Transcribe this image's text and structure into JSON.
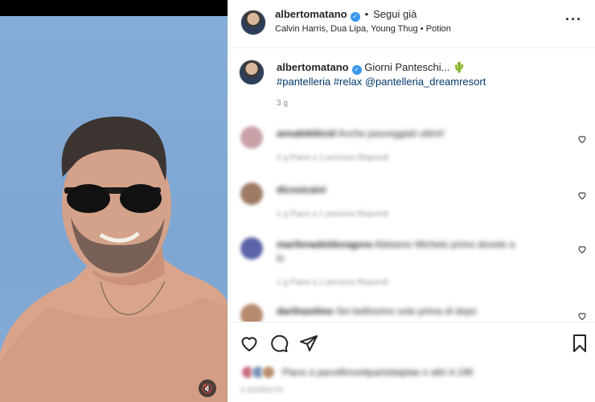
{
  "header": {
    "username": "albertomatano",
    "verified_mark": "✓",
    "separator": "•",
    "follow_label": "Segui già",
    "subtitle": "Calvin Harris, Dua Lipa, Young Thug • Potion",
    "more_label": "···"
  },
  "caption": {
    "username": "albertomatano",
    "verified_mark": "✓",
    "text": "Giorni Panteschi...",
    "emoji": "🌵",
    "hashtags": "#pantelleria #relax @pantelleria_dreamresort",
    "time": "3 g"
  },
  "comments": [
    {
      "user": "annalebiticid",
      "text": "Anche passeggiati ultimi!",
      "meta": "2 g    Piace a 1 persona    Rispondi"
    },
    {
      "user": "dicosicaivi",
      "text": "",
      "meta": "1 g    Piace a 1 persona    Rispondi"
    },
    {
      "user": "marilenadeldoragora",
      "text": "Abbiamo Michele primo dovete a",
      "text2": "lo",
      "meta": "1 g    Piace a 1 persona    Rispondi"
    },
    {
      "user": "darilnasilmo",
      "text": "Sei bellissimo sole prima di dopo",
      "meta": ""
    }
  ],
  "likes": {
    "text": "Piace a pacoifimoeitparisitaiplae e altri 4.196",
    "date": "4 GIORNI FA"
  },
  "media": {
    "mute_icon": "🔇"
  },
  "colors": {
    "verified": "#3897f0",
    "link": "#00376b",
    "muted": "#8e8e8e",
    "sky": "#7fa6d3"
  },
  "icons": [
    "heart-icon",
    "comment-icon",
    "share-icon",
    "bookmark-icon",
    "more-icon",
    "mute-icon"
  ]
}
